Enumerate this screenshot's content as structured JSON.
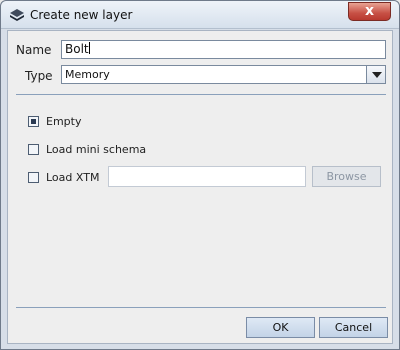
{
  "window": {
    "title": "Create new layer",
    "close_label": "x"
  },
  "form": {
    "name_label": "Name",
    "name_value": "Bolt",
    "type_label": "Type",
    "type_value": "Memory"
  },
  "options": {
    "selected": "Empty",
    "items": [
      {
        "label": "Empty",
        "checked": true
      },
      {
        "label": "Load mini schema",
        "checked": false
      },
      {
        "label": "Load XTM",
        "checked": false
      }
    ],
    "xtm_path_value": "",
    "browse_label": "Browse"
  },
  "buttons": {
    "ok_label": "OK",
    "cancel_label": "Cancel"
  }
}
